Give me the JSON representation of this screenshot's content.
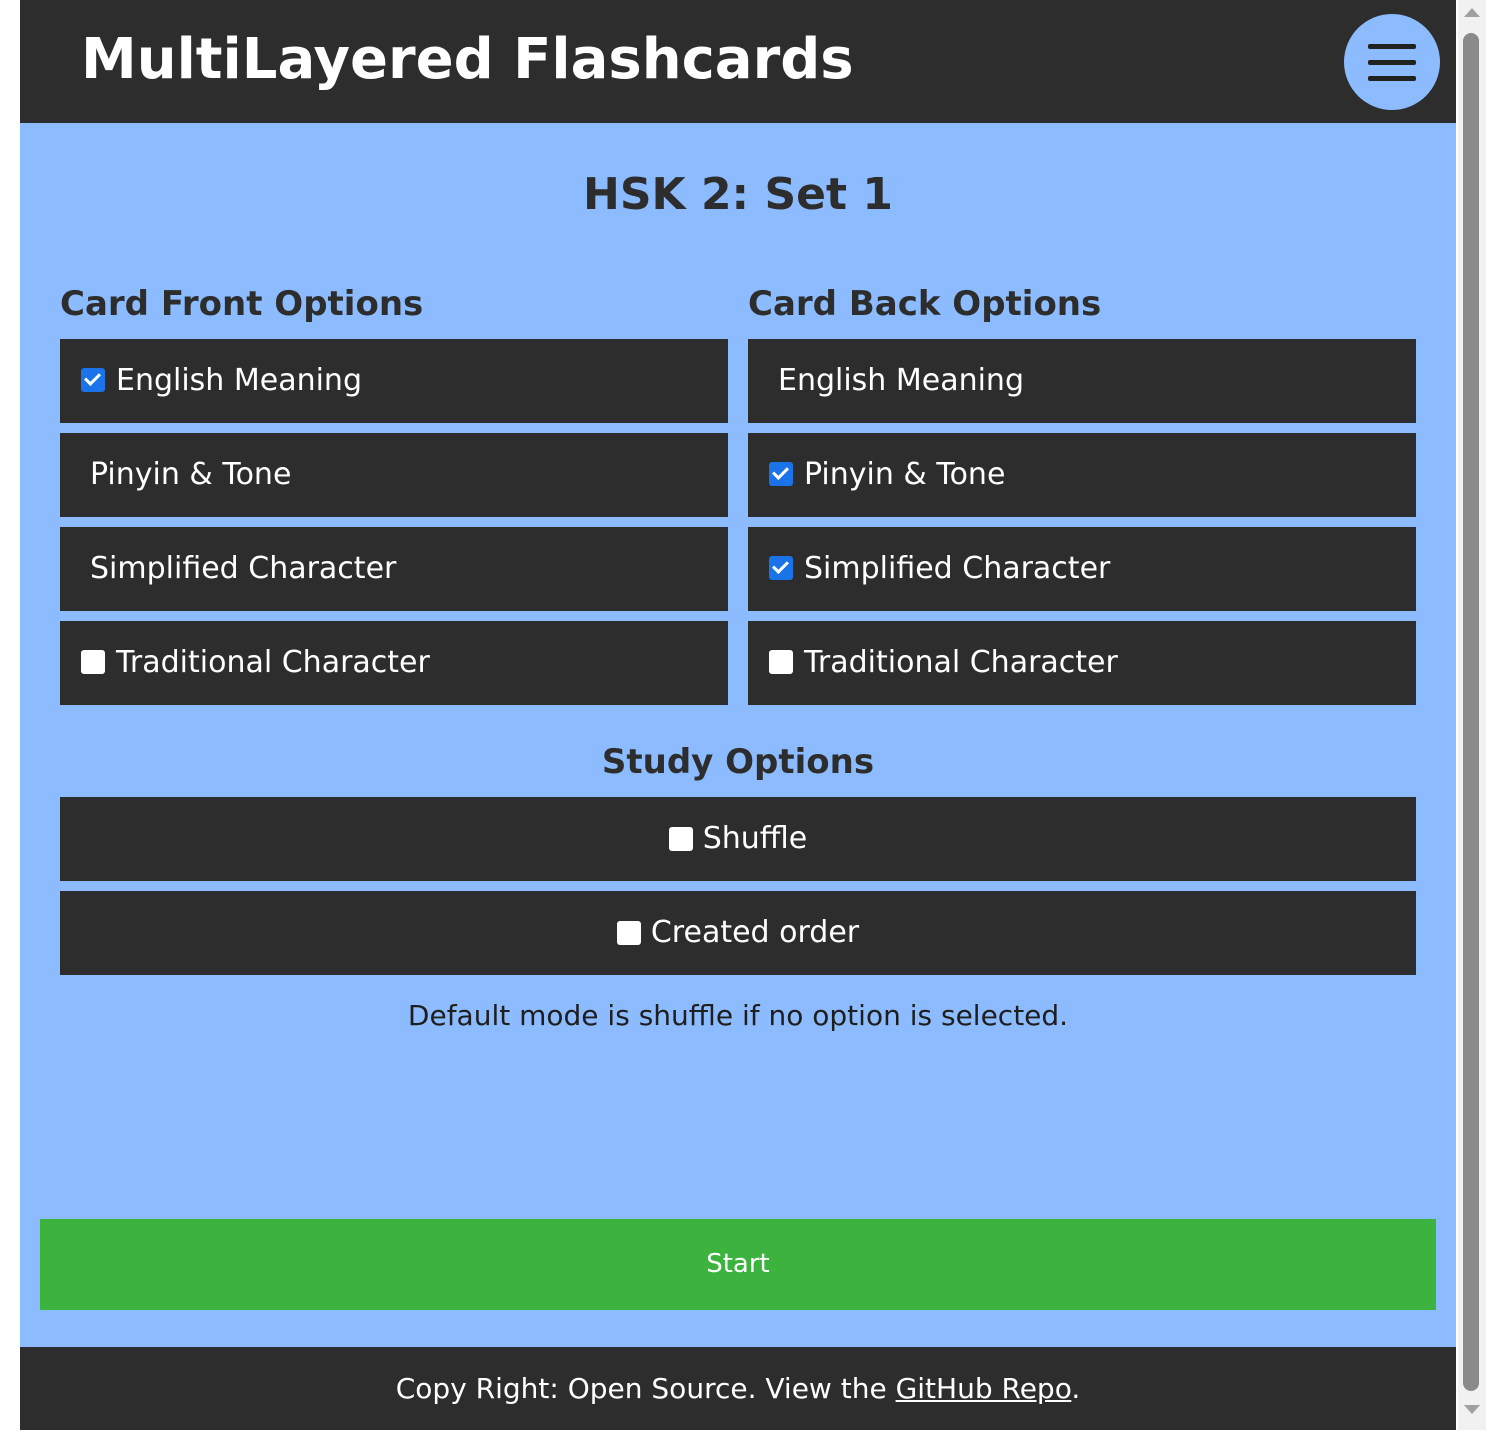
{
  "header": {
    "title": "MultiLayered Flashcards",
    "menu_icon": "hamburger-menu-icon"
  },
  "set_title": "HSK 2: Set 1",
  "front": {
    "heading": "Card Front Options",
    "options": [
      {
        "label": "English Meaning",
        "checkbox": true,
        "checked": true
      },
      {
        "label": "Pinyin & Tone",
        "checkbox": false,
        "checked": false
      },
      {
        "label": "Simplified Character",
        "checkbox": false,
        "checked": false
      },
      {
        "label": "Traditional Character",
        "checkbox": true,
        "checked": false
      }
    ]
  },
  "back": {
    "heading": "Card Back Options",
    "options": [
      {
        "label": "English Meaning",
        "checkbox": false,
        "checked": false
      },
      {
        "label": "Pinyin & Tone",
        "checkbox": true,
        "checked": true
      },
      {
        "label": "Simplified Character",
        "checkbox": true,
        "checked": true
      },
      {
        "label": "Traditional Character",
        "checkbox": true,
        "checked": false
      }
    ]
  },
  "study": {
    "heading": "Study Options",
    "options": [
      {
        "label": "Shuffle",
        "checked": false
      },
      {
        "label": "Created order",
        "checked": false
      }
    ],
    "note": "Default mode is shuffle if no option is selected."
  },
  "start_label": "Start",
  "footer": {
    "prefix": "Copy Right: Open Source. View the ",
    "link_text": "GitHub Repo",
    "suffix": "."
  },
  "colors": {
    "header_bg": "#2d2d2d",
    "page_bg": "#8cbcff",
    "start_bg": "#3cb33f",
    "checkbox_checked": "#1a73e8"
  }
}
